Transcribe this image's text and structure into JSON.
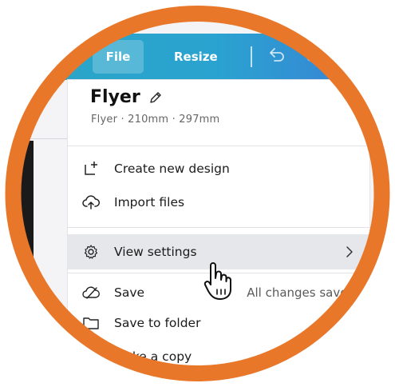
{
  "header": {
    "file_label": "File",
    "resize_label": "Resize",
    "undo_icon": "undo-icon",
    "redo_icon": "redo-icon"
  },
  "menu": {
    "title": "Flyer",
    "subtitle": "Flyer · 210mm · 297mm",
    "items": [
      {
        "label": "Create new design",
        "icon": "add-design-icon"
      },
      {
        "label": "Import files",
        "icon": "upload-cloud-icon"
      },
      {
        "label": "View settings",
        "icon": "gear-icon"
      },
      {
        "label": "Save",
        "icon": "cloud-check-icon",
        "status": "All changes saved"
      },
      {
        "label": "Save to folder",
        "icon": "folder-icon"
      },
      {
        "label": "Make a copy",
        "icon": "copy-icon"
      }
    ]
  },
  "colors": {
    "ring": "#e8772a",
    "header_start": "#2aa6c6",
    "header_end": "#3a7fd6",
    "hover_bg": "#e6e7ea"
  }
}
